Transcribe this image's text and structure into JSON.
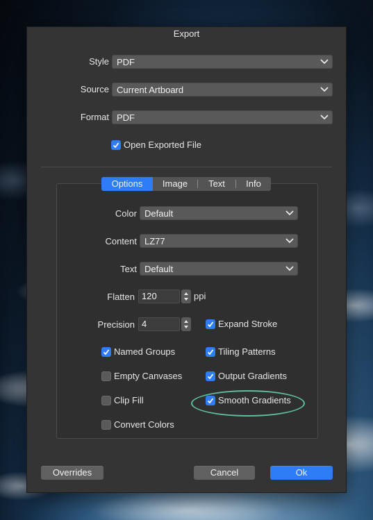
{
  "window": {
    "title": "Export"
  },
  "fields": {
    "style": {
      "label": "Style",
      "value": "PDF"
    },
    "source": {
      "label": "Source",
      "value": "Current Artboard"
    },
    "format": {
      "label": "Format",
      "value": "PDF"
    }
  },
  "open_exported": {
    "label": "Open Exported File",
    "checked": true
  },
  "tabs": [
    {
      "label": "Options",
      "active": true
    },
    {
      "label": "Image",
      "active": false
    },
    {
      "label": "Text",
      "active": false
    },
    {
      "label": "Info",
      "active": false
    }
  ],
  "options": {
    "color": {
      "label": "Color",
      "value": "Default"
    },
    "content": {
      "label": "Content",
      "value": "LZ77"
    },
    "text": {
      "label": "Text",
      "value": "Default"
    },
    "flatten": {
      "label": "Flatten",
      "value": "120",
      "unit": "ppi"
    },
    "precision": {
      "label": "Precision",
      "value": "4"
    }
  },
  "checkboxes": {
    "expand_stroke": {
      "label": "Expand Stroke",
      "checked": true
    },
    "named_groups": {
      "label": "Named Groups",
      "checked": true
    },
    "tiling_patterns": {
      "label": "Tiling Patterns",
      "checked": true
    },
    "empty_canvases": {
      "label": "Empty Canvases",
      "checked": false
    },
    "output_gradients": {
      "label": "Output Gradients",
      "checked": true
    },
    "clip_fill": {
      "label": "Clip Fill",
      "checked": false
    },
    "smooth_gradients": {
      "label": "Smooth Gradients",
      "checked": true
    },
    "convert_colors": {
      "label": "Convert Colors",
      "checked": false
    }
  },
  "buttons": {
    "overrides": "Overrides",
    "cancel": "Cancel",
    "ok": "Ok"
  },
  "colors": {
    "accent": "#2e7cf6",
    "highlight": "#5fbf9a"
  }
}
